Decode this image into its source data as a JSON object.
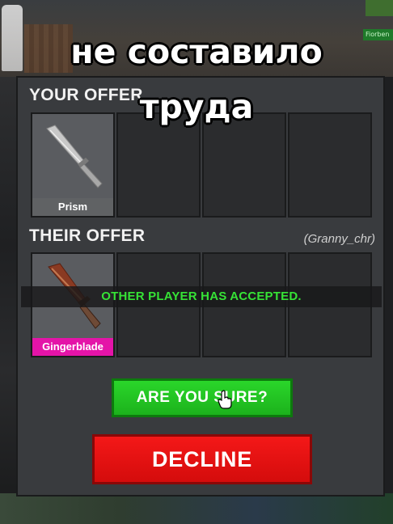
{
  "caption": {
    "line1": "не составило",
    "line2": "труда"
  },
  "background": {
    "tag_text": "Fiorben"
  },
  "trade": {
    "your_offer_label": "YOUR OFFER",
    "their_offer_label": "THEIR OFFER",
    "partner_name": "(Granny_chr)",
    "status_text": "OTHER PLAYER HAS ACCEPTED.",
    "your_items": [
      {
        "name": "Prism",
        "rarity": "common",
        "icon": "knife-icon"
      },
      null,
      null,
      null
    ],
    "their_items": [
      {
        "name": "Gingerblade",
        "rarity": "godly",
        "icon": "gingerblade-knife-icon"
      },
      null,
      null,
      null
    ],
    "confirm_label": "ARE YOU SURE?",
    "decline_label": "DECLINE"
  },
  "colors": {
    "accepted_text": "#36e336",
    "confirm_button": "#22c422",
    "decline_button": "#e11010",
    "godly_rarity": "#e414a8",
    "common_rarity": "#606264"
  }
}
